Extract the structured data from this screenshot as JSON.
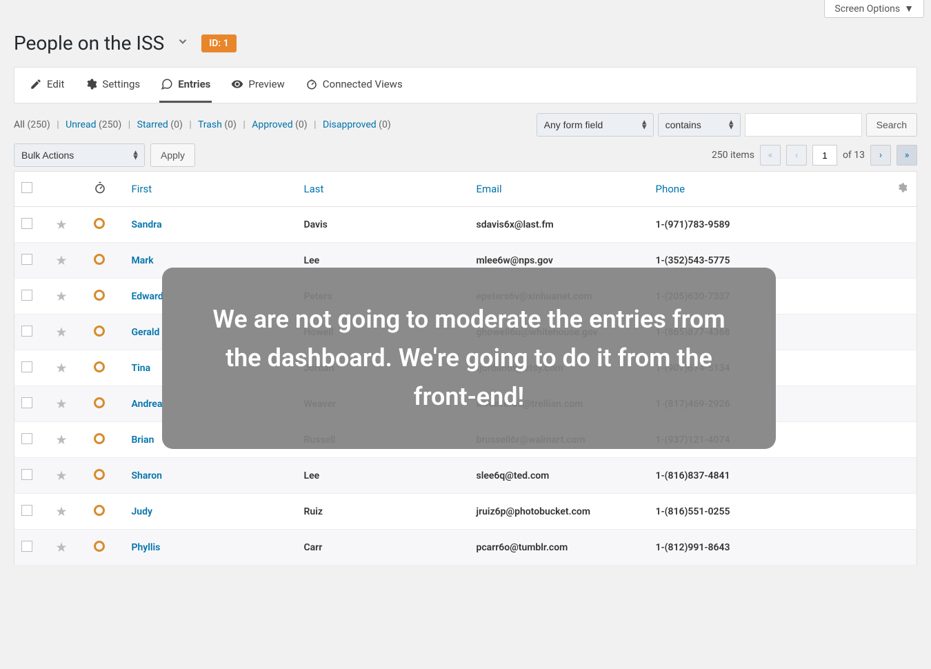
{
  "screen_options": "Screen Options",
  "page_title": "People on the ISS",
  "id_badge": "ID: 1",
  "tabs": {
    "edit": "Edit",
    "settings": "Settings",
    "entries": "Entries",
    "preview": "Preview",
    "connected": "Connected Views"
  },
  "filters": {
    "all_label": "All",
    "all_count": "(250)",
    "unread_label": "Unread",
    "unread_count": "(250)",
    "starred_label": "Starred",
    "starred_count": "(0)",
    "trash_label": "Trash",
    "trash_count": "(0)",
    "approved_label": "Approved",
    "approved_count": "(0)",
    "disapproved_label": "Disapproved",
    "disapproved_count": "(0)"
  },
  "search": {
    "field_select": "Any form field",
    "op_select": "contains",
    "button": "Search"
  },
  "bulk": {
    "select": "Bulk Actions",
    "apply": "Apply"
  },
  "pager": {
    "items": "250 items",
    "page": "1",
    "of": "of 13"
  },
  "columns": {
    "first": "First",
    "last": "Last",
    "email": "Email",
    "phone": "Phone"
  },
  "rows": [
    {
      "first": "Sandra",
      "last": "Davis",
      "email": "sdavis6x@last.fm",
      "phone": "1-(971)783-9589"
    },
    {
      "first": "Mark",
      "last": "Lee",
      "email": "mlee6w@nps.gov",
      "phone": "1-(352)543-5775"
    },
    {
      "first": "Edward",
      "last": "Peters",
      "email": "epeters6v@xinhuanet.com",
      "phone": "1-(205)630-7337"
    },
    {
      "first": "Gerald",
      "last": "Howell",
      "email": "ghowell6u@whitehouse.gov",
      "phone": "1-(865)877-4368"
    },
    {
      "first": "Tina",
      "last": "Jordan",
      "email": "tjordan6t@etsy.com",
      "phone": "1-(907)674-5134"
    },
    {
      "first": "Andrea",
      "last": "Weaver",
      "email": "aweaver6s@trellian.com",
      "phone": "1-(817)469-2926"
    },
    {
      "first": "Brian",
      "last": "Russell",
      "email": "brussell6r@walmart.com",
      "phone": "1-(937)121-4074"
    },
    {
      "first": "Sharon",
      "last": "Lee",
      "email": "slee6q@ted.com",
      "phone": "1-(816)837-4841"
    },
    {
      "first": "Judy",
      "last": "Ruiz",
      "email": "jruiz6p@photobucket.com",
      "phone": "1-(816)551-0255"
    },
    {
      "first": "Phyllis",
      "last": "Carr",
      "email": "pcarr6o@tumblr.com",
      "phone": "1-(812)991-8643"
    }
  ],
  "overlay_text": "We are not going to moderate the entries from the dashboard. We're going to do it from the front-end!"
}
